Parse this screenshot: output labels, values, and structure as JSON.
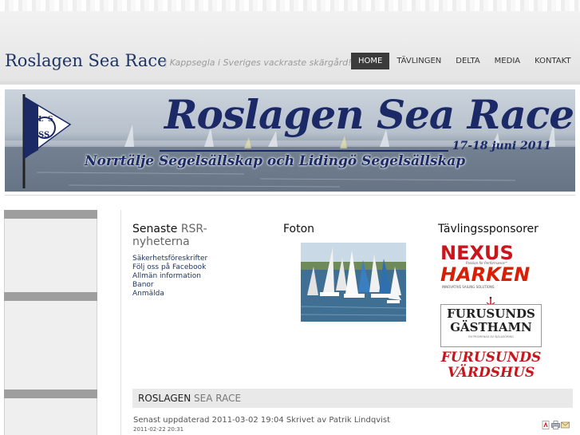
{
  "header": {
    "site_title": "Roslagen Sea Race",
    "tagline_separator": "|",
    "tagline": "Kappsegla i Sveriges vackraste skärgård!",
    "nav": [
      {
        "label": "HOME",
        "active": true
      },
      {
        "label": "TÄVLINGEN",
        "active": false
      },
      {
        "label": "DELTA",
        "active": false
      },
      {
        "label": "MEDIA",
        "active": false
      },
      {
        "label": "KONTAKT",
        "active": false
      }
    ]
  },
  "banner": {
    "title": "Roslagen Sea Race",
    "date": "17-18 juni 2011",
    "subtitle": "Norrtälje Segelsällskap och Lidingö Segelsällskap",
    "flag_letters": [
      "L",
      "S",
      "SS"
    ]
  },
  "news": {
    "title_main": "Senaste",
    "title_accent": "RSR-nyheterna",
    "links": [
      "Säkerhetsföreskrifter",
      "Följ oss på Facebook",
      "Allmän information",
      "Banor",
      "Anmälda"
    ]
  },
  "photos": {
    "title": "Foton"
  },
  "sponsors": {
    "title": "Tävlingssponsorer",
    "nexus": {
      "name": "NEXUS",
      "tagline": "Passion for Performance™"
    },
    "harken": {
      "name": "HARKEN",
      "tagline": "INNOVATIVE SAILING SOLUTIONS"
    },
    "gasthamn": {
      "line1": "FURUSUNDS",
      "line2": "GÄSTHAMN",
      "tagline": "EN PROMENAD AV SJÄLASÖRING"
    },
    "vardshus": {
      "line1": "FURUSUNDS",
      "line2": "VÄRDSHUS"
    }
  },
  "article": {
    "section_main": "ROSLAGEN",
    "section_accent": "SEA RACE",
    "meta": "Senast uppdaterad 2011-03-02 19:04 Skrivet av Patrik Lindqvist",
    "date": "2011-02-22 20:31"
  },
  "icons": [
    "pdf-icon",
    "print-icon",
    "email-icon"
  ],
  "colors": {
    "brand_blue": "#1e3563",
    "nav_active_bg": "#3b3b3b",
    "sponsor_red": "#c8161d"
  }
}
